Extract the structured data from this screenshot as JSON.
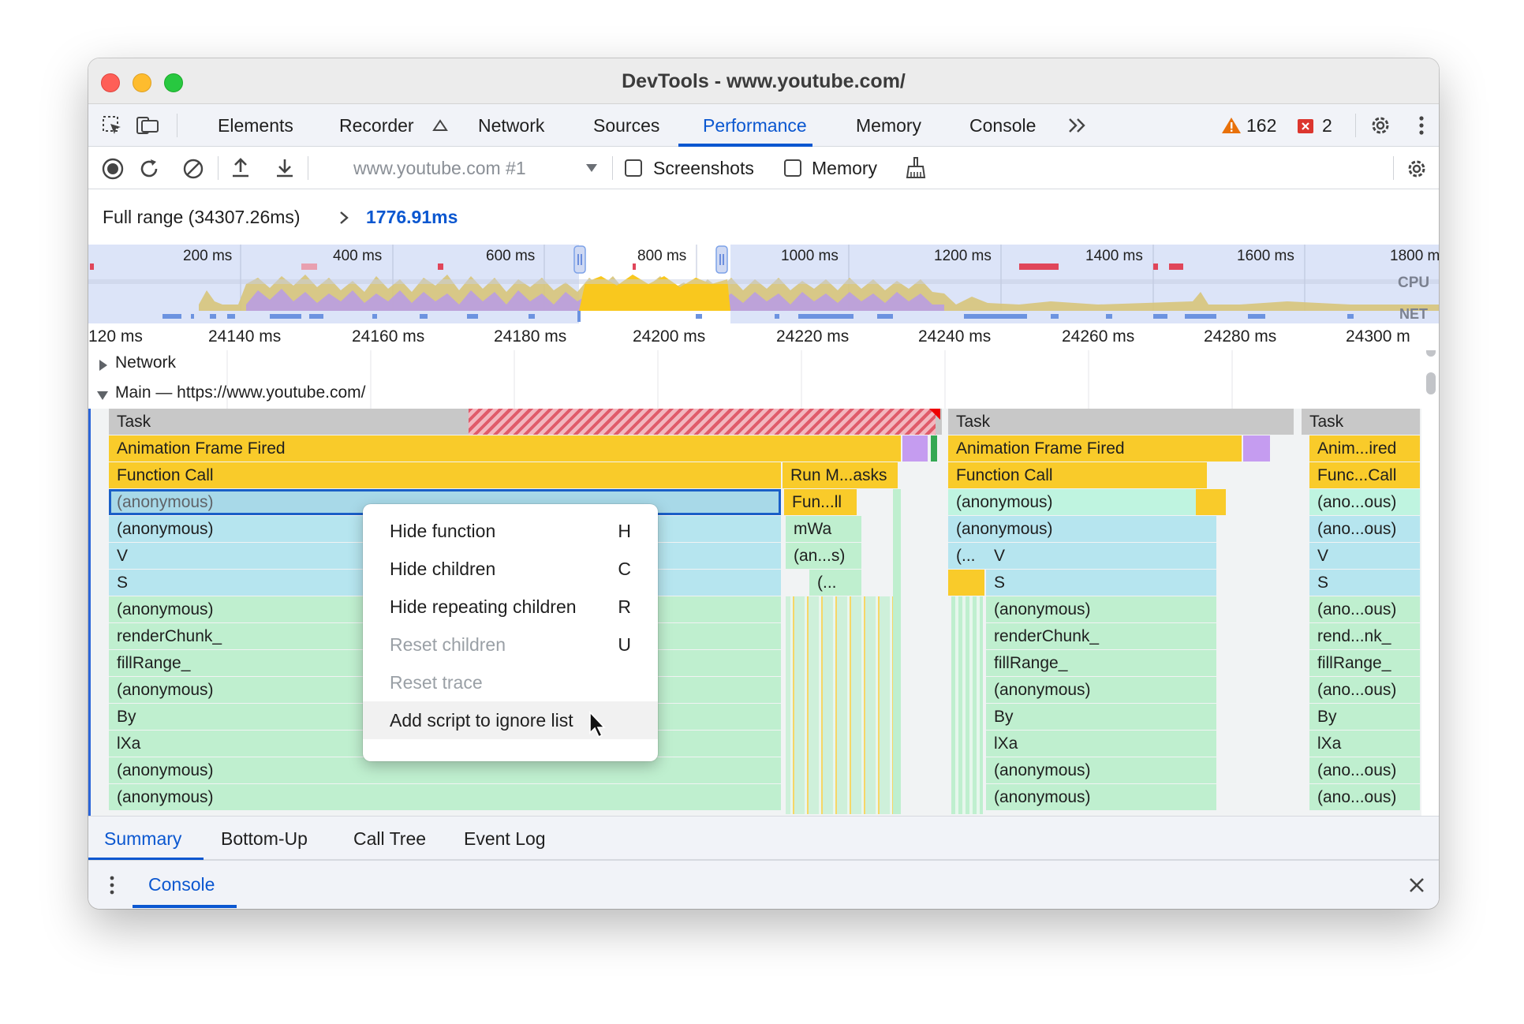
{
  "window": {
    "title": "DevTools - www.youtube.com/"
  },
  "tabs": [
    "Elements",
    "Recorder",
    "Network",
    "Sources",
    "Performance",
    "Memory",
    "Console"
  ],
  "active_tab": "Performance",
  "status": {
    "warnings": "162",
    "errors": "2"
  },
  "toolbar": {
    "profile_select": "www.youtube.com #1",
    "screenshots_label": "Screenshots",
    "memory_label": "Memory"
  },
  "range": {
    "full": "Full range (34307.26ms)",
    "selected": "1776.91ms"
  },
  "overview": {
    "ticks": [
      "200 ms",
      "400 ms",
      "600 ms",
      "800 ms",
      "1000 ms",
      "1200 ms",
      "1400 ms",
      "1600 ms",
      "1800 m"
    ],
    "cpu_label": "CPU",
    "net_label": "NET"
  },
  "ruler": [
    "120 ms",
    "24140 ms",
    "24160 ms",
    "24180 ms",
    "24200 ms",
    "24220 ms",
    "24240 ms",
    "24260 ms",
    "24280 ms",
    "24300 m"
  ],
  "tracks": {
    "network": "Network",
    "main": "Main — https://www.youtube.com/"
  },
  "flame": {
    "left": [
      "Task",
      "Animation Frame Fired",
      "Function Call",
      "(anonymous)",
      "(anonymous)",
      "V",
      "S",
      "(anonymous)",
      "renderChunk_",
      "fillRange_",
      "(anonymous)",
      "By",
      "lXa",
      "(anonymous)",
      "(anonymous)"
    ],
    "mid": [
      "Run M...asks",
      "Fun...ll",
      "mWa",
      "(an...s)",
      "(..."
    ],
    "right": [
      "Task",
      "Animation Frame Fired",
      "Function Call",
      "(anonymous)",
      "(anonymous)",
      "(...",
      "V",
      "S",
      "(anonymous)",
      "renderChunk_",
      "fillRange_",
      "(anonymous)",
      "By",
      "lXa",
      "(anonymous)",
      "(anonymous)"
    ],
    "far": [
      "Task",
      "Anim...ired",
      "Func...Call",
      "(ano...ous)",
      "(ano...ous)",
      "V",
      "S",
      "(ano...ous)",
      "rend...nk_",
      "fillRange_",
      "(ano...ous)",
      "By",
      "lXa",
      "(ano...ous)",
      "(ano...ous)"
    ]
  },
  "context_menu": [
    {
      "label": "Hide function",
      "key": "H",
      "enabled": true
    },
    {
      "label": "Hide children",
      "key": "C",
      "enabled": true
    },
    {
      "label": "Hide repeating children",
      "key": "R",
      "enabled": true
    },
    {
      "label": "Reset children",
      "key": "U",
      "enabled": false
    },
    {
      "label": "Reset trace",
      "key": "",
      "enabled": false
    },
    {
      "label": "Add script to ignore list",
      "key": "",
      "enabled": true
    }
  ],
  "bottom_tabs": [
    "Summary",
    "Bottom-Up",
    "Call Tree",
    "Event Log"
  ],
  "active_bottom_tab": "Summary",
  "drawer": {
    "tab": "Console"
  },
  "colors": {
    "accent": "#0b57d0",
    "task": "#c8c8c8",
    "animation": "#f9cb2a",
    "anon_blue": "#b6e5ef",
    "anon_green": "#bfefcf",
    "long_task": "#e05b6a"
  }
}
